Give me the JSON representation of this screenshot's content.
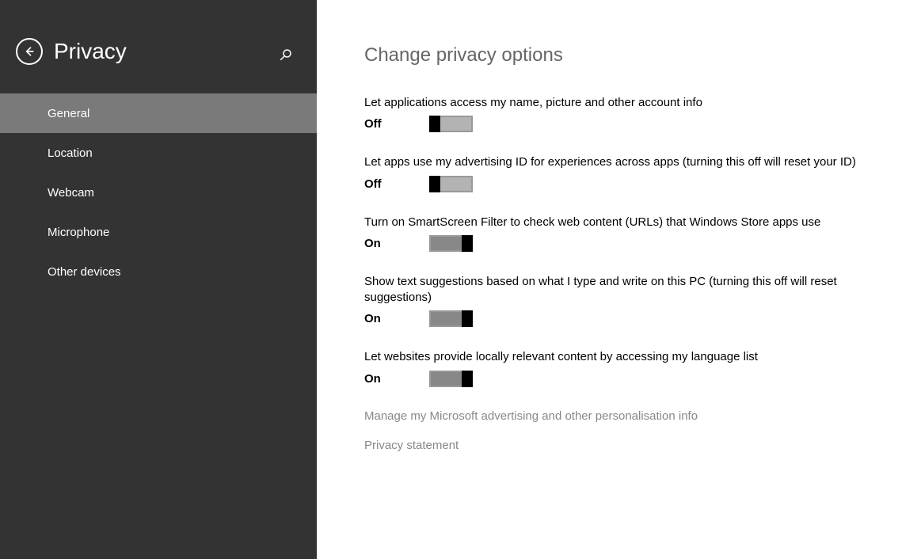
{
  "sidebar": {
    "title": "Privacy",
    "items": [
      {
        "label": "General",
        "selected": true
      },
      {
        "label": "Location",
        "selected": false
      },
      {
        "label": "Webcam",
        "selected": false
      },
      {
        "label": "Microphone",
        "selected": false
      },
      {
        "label": "Other devices",
        "selected": false
      }
    ]
  },
  "main": {
    "title": "Change privacy options",
    "settings": [
      {
        "desc": "Let applications access my name, picture and other account info",
        "state": "Off"
      },
      {
        "desc": "Let apps use my advertising ID for experiences across apps (turning this off will reset your ID)",
        "state": "Off"
      },
      {
        "desc": "Turn on SmartScreen Filter to check web content (URLs) that Windows Store apps use",
        "state": "On"
      },
      {
        "desc": "Show text suggestions based on what I type and write on this PC (turning this off will reset suggestions)",
        "state": "On"
      },
      {
        "desc": "Let websites provide locally relevant content by accessing my language list",
        "state": "On"
      }
    ],
    "links": [
      "Manage my Microsoft advertising and other personalisation info",
      "Privacy statement"
    ]
  }
}
